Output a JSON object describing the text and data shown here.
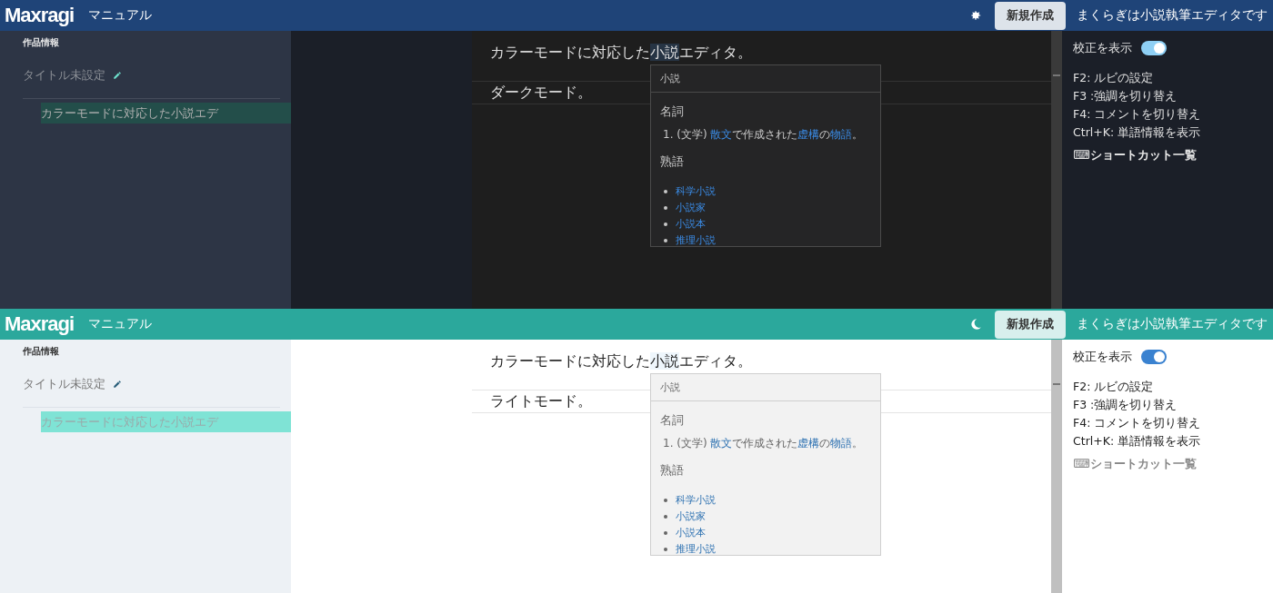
{
  "screens": [
    {
      "kind": "dark",
      "header": {
        "logo": "Maxragi",
        "nav_link": "マニュアル",
        "new_button": "新規作成",
        "tagline": "まくらぎは小説執筆エディタです"
      },
      "sidebar": {
        "section_label": "作品情報",
        "title": "タイトル未設定",
        "chapters": [
          {
            "label": "カラーモードに対応した小説エデ",
            "selected": true
          }
        ]
      },
      "editor": {
        "paragraphs": [
          {
            "active": false,
            "segments": [
              {
                "text": "カラーモードに対応した",
                "highlighted": false
              },
              {
                "text": "小説",
                "highlighted": true
              },
              {
                "text": "エディタ。",
                "highlighted": false
              }
            ]
          },
          {
            "active": true,
            "segments": [
              {
                "text": "ダークモード。",
                "highlighted": false
              }
            ]
          }
        ],
        "popup": {
          "word": "小説",
          "pos": "名詞",
          "definitions": [
            {
              "number": "1.",
              "segments": [
                {
                  "text": "(文学) ",
                  "link": false
                },
                {
                  "text": "散文",
                  "link": true
                },
                {
                  "text": "で作成された",
                  "link": false
                },
                {
                  "text": "虚構",
                  "link": true
                },
                {
                  "text": "の",
                  "link": false
                },
                {
                  "text": "物語",
                  "link": true
                },
                {
                  "text": "。",
                  "link": false
                }
              ]
            }
          ],
          "idioms_heading": "熟語",
          "idioms": [
            "科学小説",
            "小説家",
            "小説本",
            "推理小説"
          ]
        }
      },
      "panel": {
        "toggle": {
          "label": "校正を表示",
          "on": true
        },
        "shortcuts": [
          "F2: ルビの設定",
          "F3 :強調を切り替え",
          "F4: コメントを切り替え",
          "Ctrl+K: 単語情報を表示"
        ],
        "shortcut_link": "⌨ショートカット一覧"
      }
    },
    {
      "kind": "light",
      "header": {
        "logo": "Maxragi",
        "nav_link": "マニュアル",
        "new_button": "新規作成",
        "tagline": "まくらぎは小説執筆エディタです"
      },
      "sidebar": {
        "section_label": "作品情報",
        "title": "タイトル未設定",
        "chapters": [
          {
            "label": "カラーモードに対応した小説エデ",
            "selected": true
          }
        ]
      },
      "editor": {
        "paragraphs": [
          {
            "active": false,
            "segments": [
              {
                "text": "カラーモードに対応した",
                "highlighted": false
              },
              {
                "text": "小説",
                "highlighted": true
              },
              {
                "text": "エディタ。",
                "highlighted": false
              }
            ]
          },
          {
            "active": true,
            "segments": [
              {
                "text": "ライトモード。",
                "highlighted": false
              }
            ]
          }
        ],
        "popup": {
          "word": "小説",
          "pos": "名詞",
          "definitions": [
            {
              "number": "1.",
              "segments": [
                {
                  "text": "(文学) ",
                  "link": false
                },
                {
                  "text": "散文",
                  "link": true
                },
                {
                  "text": "で作成された",
                  "link": false
                },
                {
                  "text": "虚構",
                  "link": true
                },
                {
                  "text": "の",
                  "link": false
                },
                {
                  "text": "物語",
                  "link": true
                },
                {
                  "text": "。",
                  "link": false
                }
              ]
            }
          ],
          "idioms_heading": "熟語",
          "idioms": [
            "科学小説",
            "小説家",
            "小説本",
            "推理小説"
          ]
        }
      },
      "panel": {
        "toggle": {
          "label": "校正を表示",
          "on": true
        },
        "shortcuts": [
          "F2: ルビの設定",
          "F3 :強調を切り替え",
          "F4: コメントを切り替え",
          "Ctrl+K: 単語情報を表示"
        ],
        "shortcut_link": "⌨ショートカット一覧"
      }
    }
  ]
}
